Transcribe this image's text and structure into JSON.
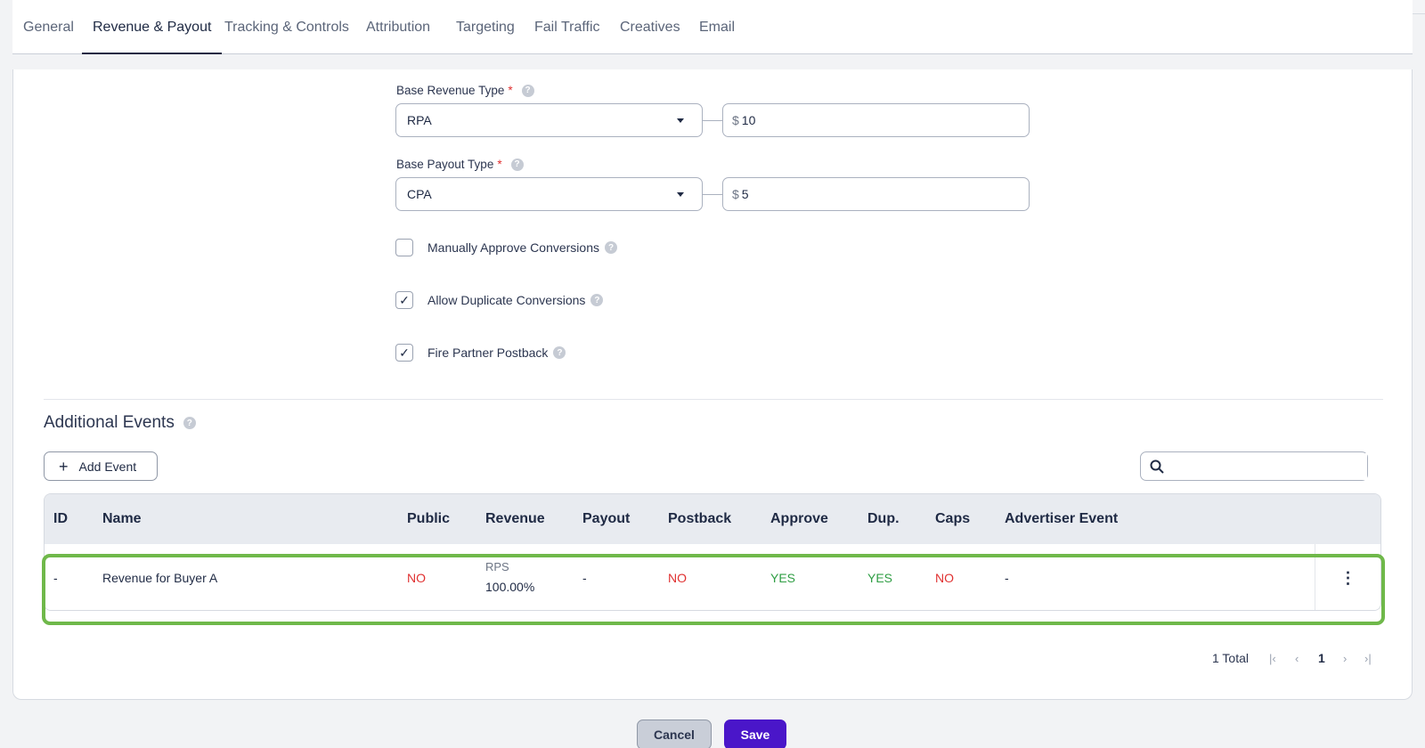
{
  "tabs": [
    "General",
    "Revenue & Payout",
    "Tracking & Controls",
    "Attribution",
    "Targeting",
    "Fail Traffic",
    "Creatives",
    "Email"
  ],
  "active_tab": "Revenue & Payout",
  "form": {
    "base_revenue": {
      "label": "Base Revenue Type",
      "required_mark": "*",
      "type_value": "RPA",
      "currency": "$",
      "amount": "10"
    },
    "base_payout": {
      "label": "Base Payout Type",
      "required_mark": "*",
      "type_value": "CPA",
      "currency": "$",
      "amount": "5"
    },
    "checkboxes": [
      {
        "label": "Manually Approve Conversions",
        "checked": false
      },
      {
        "label": "Allow Duplicate Conversions",
        "checked": true
      },
      {
        "label": "Fire Partner Postback",
        "checked": true
      }
    ]
  },
  "additional_events": {
    "title": "Additional Events",
    "add_button": "Add Event",
    "search_placeholder": "",
    "columns": [
      "ID",
      "Name",
      "Public",
      "Revenue",
      "Payout",
      "Postback",
      "Approve",
      "Dup.",
      "Caps",
      "Advertiser Event"
    ],
    "rows": [
      {
        "id": "-",
        "name": "Revenue for Buyer A",
        "public": "NO",
        "revenue_type": "RPS",
        "revenue_value": "100.00%",
        "payout": "-",
        "postback": "NO",
        "approve": "YES",
        "dup": "YES",
        "caps": "NO",
        "advertiser_event": "-"
      }
    ],
    "total": "1 Total",
    "current_page": "1"
  },
  "footer": {
    "cancel": "Cancel",
    "save": "Save"
  },
  "colors": {
    "accent": "#4a16c9",
    "yes": "#2f9e44",
    "no": "#e03131",
    "highlight": "#6fb84a"
  }
}
